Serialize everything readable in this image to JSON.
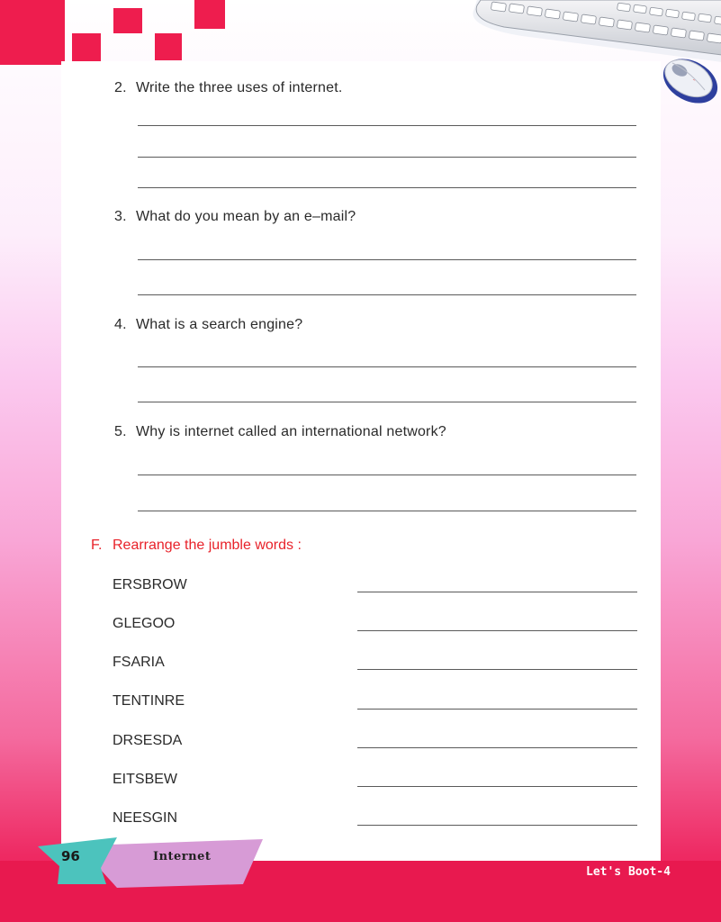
{
  "questions": [
    {
      "num": "2.",
      "text": "Write the three uses of internet."
    },
    {
      "num": "3.",
      "text": "What do you mean by an e–mail?"
    },
    {
      "num": "4.",
      "text": "What is a search engine?"
    },
    {
      "num": "5.",
      "text": "Why is internet called an international network?"
    }
  ],
  "section_f": {
    "letter": "F.",
    "title": "Rearrange the jumble words :",
    "words": [
      "ERSBROW",
      "GLEGOO",
      "FSARIA",
      "TENTINRE",
      "DRSESDA",
      "EITSBEW",
      "NEESGIN"
    ]
  },
  "footer": {
    "page_number": "96",
    "chapter": "Internet",
    "series": "Let's Boot-4"
  },
  "colors": {
    "accent_red": "#ee1d4e",
    "section_title": "#e8222a",
    "page_tab_teal": "#4cc3bd",
    "page_tab_lilac": "#d79bd6"
  },
  "icons": [
    "keyboard-image",
    "mouse-image"
  ]
}
